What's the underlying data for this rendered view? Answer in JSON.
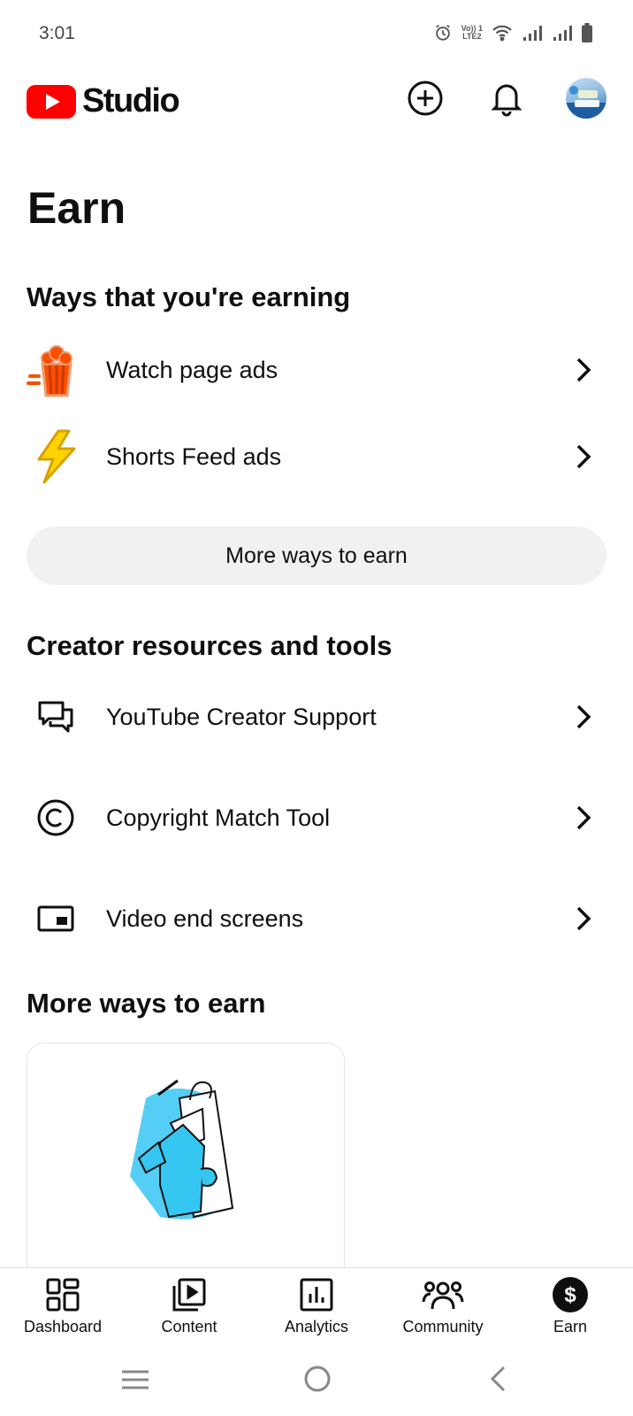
{
  "status_bar": {
    "time": "3:01",
    "volte_top": "Vo)) 1",
    "volte_bottom": "LTE2"
  },
  "header": {
    "logo_text": "Studio",
    "icons": {
      "logo": "youtube-play-logo",
      "create": "add-circle-icon",
      "notifications": "bell-icon",
      "account": "avatar"
    }
  },
  "page": {
    "title": "Earn"
  },
  "earning": {
    "title": "Ways that you're earning",
    "items": [
      {
        "label": "Watch page ads",
        "icon": "popcorn-icon"
      },
      {
        "label": "Shorts Feed ads",
        "icon": "lightning-icon"
      }
    ],
    "more_button": "More ways to earn"
  },
  "resources": {
    "title": "Creator resources and tools",
    "items": [
      {
        "label": "YouTube Creator Support",
        "icon": "chat-bubbles-icon"
      },
      {
        "label": "Copyright Match Tool",
        "icon": "copyright-icon"
      },
      {
        "label": "Video end screens",
        "icon": "end-screen-icon"
      }
    ]
  },
  "more_ways": {
    "title": "More ways to earn",
    "card_illustration": "shopping-bags-illustration"
  },
  "bottom_nav": {
    "active": "Earn",
    "items": [
      {
        "label": "Dashboard",
        "icon": "dashboard-icon"
      },
      {
        "label": "Content",
        "icon": "content-icon"
      },
      {
        "label": "Analytics",
        "icon": "analytics-icon"
      },
      {
        "label": "Community",
        "icon": "community-icon"
      },
      {
        "label": "Earn",
        "icon": "dollar-icon"
      }
    ]
  },
  "colors": {
    "brand_red": "#ff0000",
    "text": "#0f0f0f",
    "chip_bg": "#f1f1f1",
    "popcorn": "#ff4e00",
    "lightning": "#ffd400",
    "illustration_cyan": "#36c6f2"
  }
}
